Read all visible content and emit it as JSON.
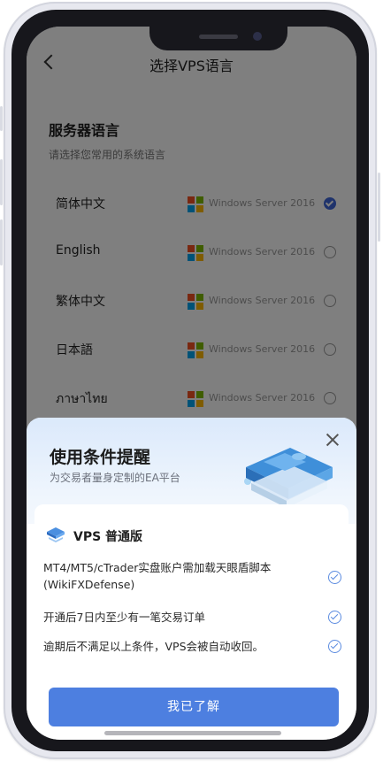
{
  "nav": {
    "title": "选择VPS语言"
  },
  "section": {
    "title": "服务器语言",
    "subtitle": "请选择您常用的系统语言"
  },
  "languages": [
    {
      "name": "简体中文",
      "os": "Windows Server 2016",
      "selected": true
    },
    {
      "name": "English",
      "os": "Windows Server 2016",
      "selected": false
    },
    {
      "name": "繁体中文",
      "os": "Windows Server 2016",
      "selected": false
    },
    {
      "name": "日本語",
      "os": "Windows Server 2016",
      "selected": false
    },
    {
      "name": "ภาษาไทย",
      "os": "Windows Server 2016",
      "selected": false
    }
  ],
  "sheet": {
    "title": "使用条件提醒",
    "subtitle": "为交易者量身定制的EA平台",
    "plan": "VPS 普通版",
    "conditions": [
      "MT4/MT5/cTrader实盘账户需加载天眼盾脚本(WikiFXDefense)",
      "开通后7日内至少有一笔交易订单",
      "逾期后不满足以上条件，VPS会被自动收回。"
    ],
    "button": "我已了解"
  },
  "colors": {
    "accent": "#4d7fe0",
    "selected_radio": "#3f67d8"
  },
  "icons": [
    "back-icon",
    "windows-icon",
    "close-icon",
    "vps-plan-icon",
    "check-circle-icon"
  ]
}
